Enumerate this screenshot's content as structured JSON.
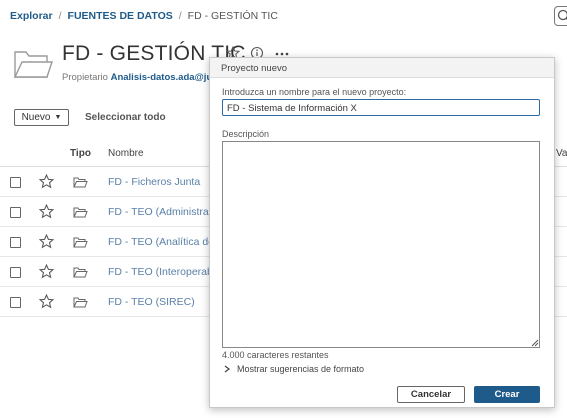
{
  "breadcrumb": {
    "items": [
      "Explorar",
      "FUENTES DE DATOS"
    ],
    "separator": "/",
    "current": "FD - GESTIÓN TIC"
  },
  "header": {
    "title": "FD - GESTIÓN TIC",
    "owner_label": "Propietario",
    "owner_value": "Analisis-datos.ada@junta"
  },
  "toolbar": {
    "new_label": "Nuevo",
    "select_all_label": "Seleccionar todo"
  },
  "table": {
    "columns": {
      "type": "Tipo",
      "name": "Nombre",
      "value": "Val"
    },
    "rows": [
      {
        "name": "FD - Ficheros Junta"
      },
      {
        "name": "FD - TEO (Administracc"
      },
      {
        "name": "FD - TEO (Analítica de D"
      },
      {
        "name": "FD - TEO (Interoperabil"
      },
      {
        "name": "FD - TEO (SIREC)"
      }
    ]
  },
  "dialog": {
    "title": "Proyecto nuevo",
    "name_label": "Introduzca un nombre para el nuevo proyecto:",
    "name_value": "FD - Sistema de Información X",
    "description_label": "Descripción",
    "description_value": "",
    "chars_remaining": "4.000 caracteres restantes",
    "format_suggestions": "Mostrar sugerencias de formato",
    "cancel_label": "Cancelar",
    "create_label": "Crear"
  },
  "colors": {
    "accent": "#1f5b8a",
    "link": "#5a80a9"
  },
  "icons": [
    "search-icon",
    "folder-icon",
    "star-icon",
    "info-icon",
    "more-icon",
    "chevron-right-icon",
    "resize-handle-icon"
  ]
}
